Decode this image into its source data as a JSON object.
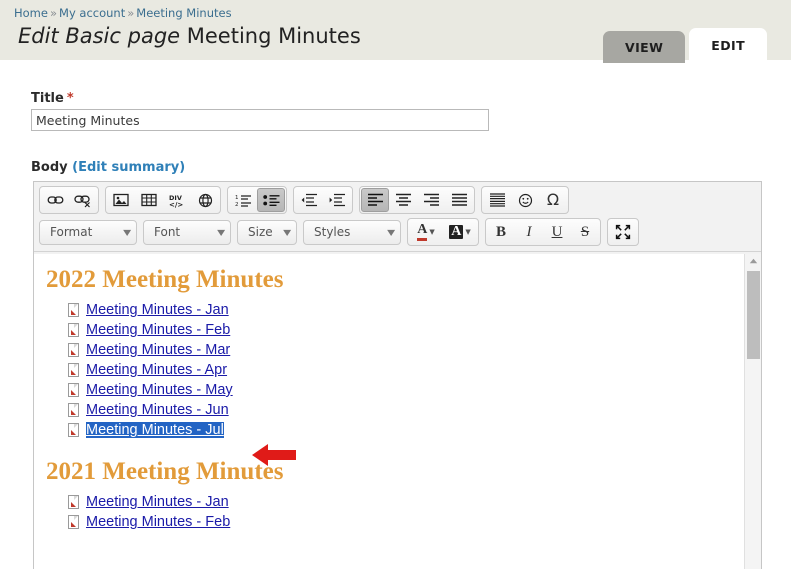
{
  "breadcrumb": {
    "items": [
      "Home",
      "My account",
      "Meeting Minutes"
    ],
    "separator": "»"
  },
  "page": {
    "title_prefix": "Edit Basic page",
    "title_name": "Meeting Minutes"
  },
  "tabs": [
    {
      "label": "VIEW",
      "active": false
    },
    {
      "label": "EDIT",
      "active": true
    }
  ],
  "title_field": {
    "label": "Title",
    "required_marker": "*",
    "value": "Meeting Minutes",
    "placeholder": ""
  },
  "body_field": {
    "label": "Body",
    "edit_summary_link": "(Edit summary)"
  },
  "toolbar": {
    "row1": [
      {
        "name": "link",
        "glyph": "link"
      },
      {
        "name": "unlink",
        "glyph": "unlink"
      },
      {
        "name": "image",
        "glyph": "image"
      },
      {
        "name": "table",
        "glyph": "table"
      },
      {
        "name": "div-container",
        "glyph": "div"
      },
      {
        "name": "anchor-globe",
        "glyph": "globe"
      },
      {
        "name": "numbered-list",
        "glyph": "ol",
        "active": false
      },
      {
        "name": "bulleted-list",
        "glyph": "ul",
        "active": true
      },
      {
        "name": "decrease-indent",
        "glyph": "outdent"
      },
      {
        "name": "increase-indent",
        "glyph": "indent"
      },
      {
        "name": "align-left",
        "glyph": "align-left",
        "active": true
      },
      {
        "name": "align-center",
        "glyph": "align-center"
      },
      {
        "name": "align-right",
        "glyph": "align-right"
      },
      {
        "name": "align-justify",
        "glyph": "align-justify"
      },
      {
        "name": "horizontal-rule",
        "glyph": "hr"
      },
      {
        "name": "smiley",
        "glyph": "smiley"
      },
      {
        "name": "special-character",
        "glyph": "omega"
      }
    ],
    "selects": [
      {
        "name": "format",
        "label": "Format",
        "value": "Format"
      },
      {
        "name": "font",
        "label": "Font",
        "value": "Font"
      },
      {
        "name": "size",
        "label": "Size",
        "value": "Size"
      },
      {
        "name": "styles",
        "label": "Styles",
        "value": "Styles"
      }
    ],
    "row2_buttons": [
      {
        "name": "text-color",
        "glyph": "A-underline"
      },
      {
        "name": "background-color",
        "glyph": "A-box"
      },
      {
        "name": "bold",
        "glyph": "B"
      },
      {
        "name": "italic",
        "glyph": "I"
      },
      {
        "name": "underline",
        "glyph": "U"
      },
      {
        "name": "strikethrough",
        "glyph": "S"
      },
      {
        "name": "maximize",
        "glyph": "maximize"
      }
    ],
    "symbols": {
      "omega": "Ω",
      "smiley": "☺",
      "bold": "B",
      "italic": "I",
      "underline": "U",
      "strike": "S",
      "letter_a": "A",
      "caret": "▼"
    }
  },
  "editor_content": {
    "sections": [
      {
        "heading": "2022 Meeting Minutes",
        "links": [
          {
            "text": "Meeting Minutes - Jan",
            "selected": false
          },
          {
            "text": "Meeting Minutes - Feb",
            "selected": false
          },
          {
            "text": "Meeting Minutes - Mar",
            "selected": false
          },
          {
            "text": "Meeting Minutes - Apr",
            "selected": false
          },
          {
            "text": "Meeting Minutes - May",
            "selected": false
          },
          {
            "text": "Meeting Minutes - Jun",
            "selected": false
          },
          {
            "text": "Meeting Minutes - Jul",
            "selected": true
          }
        ]
      },
      {
        "heading": "2021 Meeting Minutes",
        "links": [
          {
            "text": "Meeting Minutes - Jan",
            "selected": false
          },
          {
            "text": "Meeting Minutes - Feb",
            "selected": false
          }
        ]
      }
    ]
  },
  "annotation": {
    "arrow_color": "#e01b18",
    "arrow_points_to": "Meeting Minutes - Jul"
  },
  "colors": {
    "header_band": "#e9e9e1",
    "heading_orange": "#e29b3a",
    "link_blue": "#1a1aa8",
    "selection_blue": "#2364c4",
    "tab_inactive": "#a7a7a2",
    "required_red": "#c0392b",
    "breadcrumb_link": "#3b6e8f"
  },
  "scrollbar": {
    "up_arrow": "▲",
    "thumb_position": "top"
  }
}
